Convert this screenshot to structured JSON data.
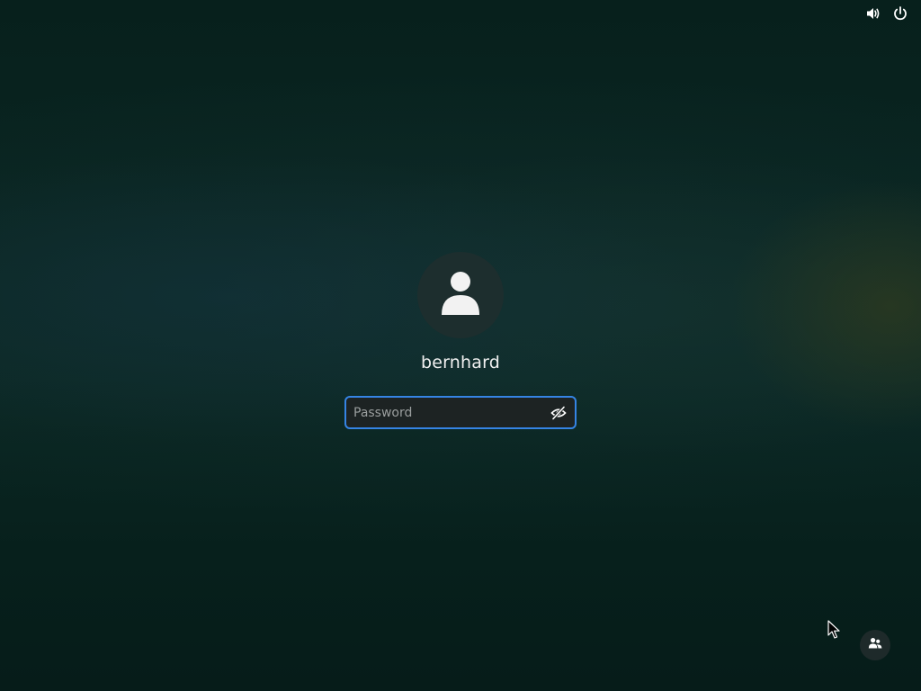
{
  "top_bar": {
    "icons": [
      "volume-icon",
      "power-icon"
    ]
  },
  "login": {
    "avatar_icon": "user-avatar-icon",
    "username": "bernhard",
    "password": {
      "value": "",
      "placeholder": "Password",
      "reveal_icon": "eye-hidden-icon"
    }
  },
  "bottom": {
    "switch_user_icon": "users-icon"
  },
  "colors": {
    "focus_ring": "#3584e4",
    "background": "#0a2622",
    "avatar_bg": "#1d2e2e"
  }
}
